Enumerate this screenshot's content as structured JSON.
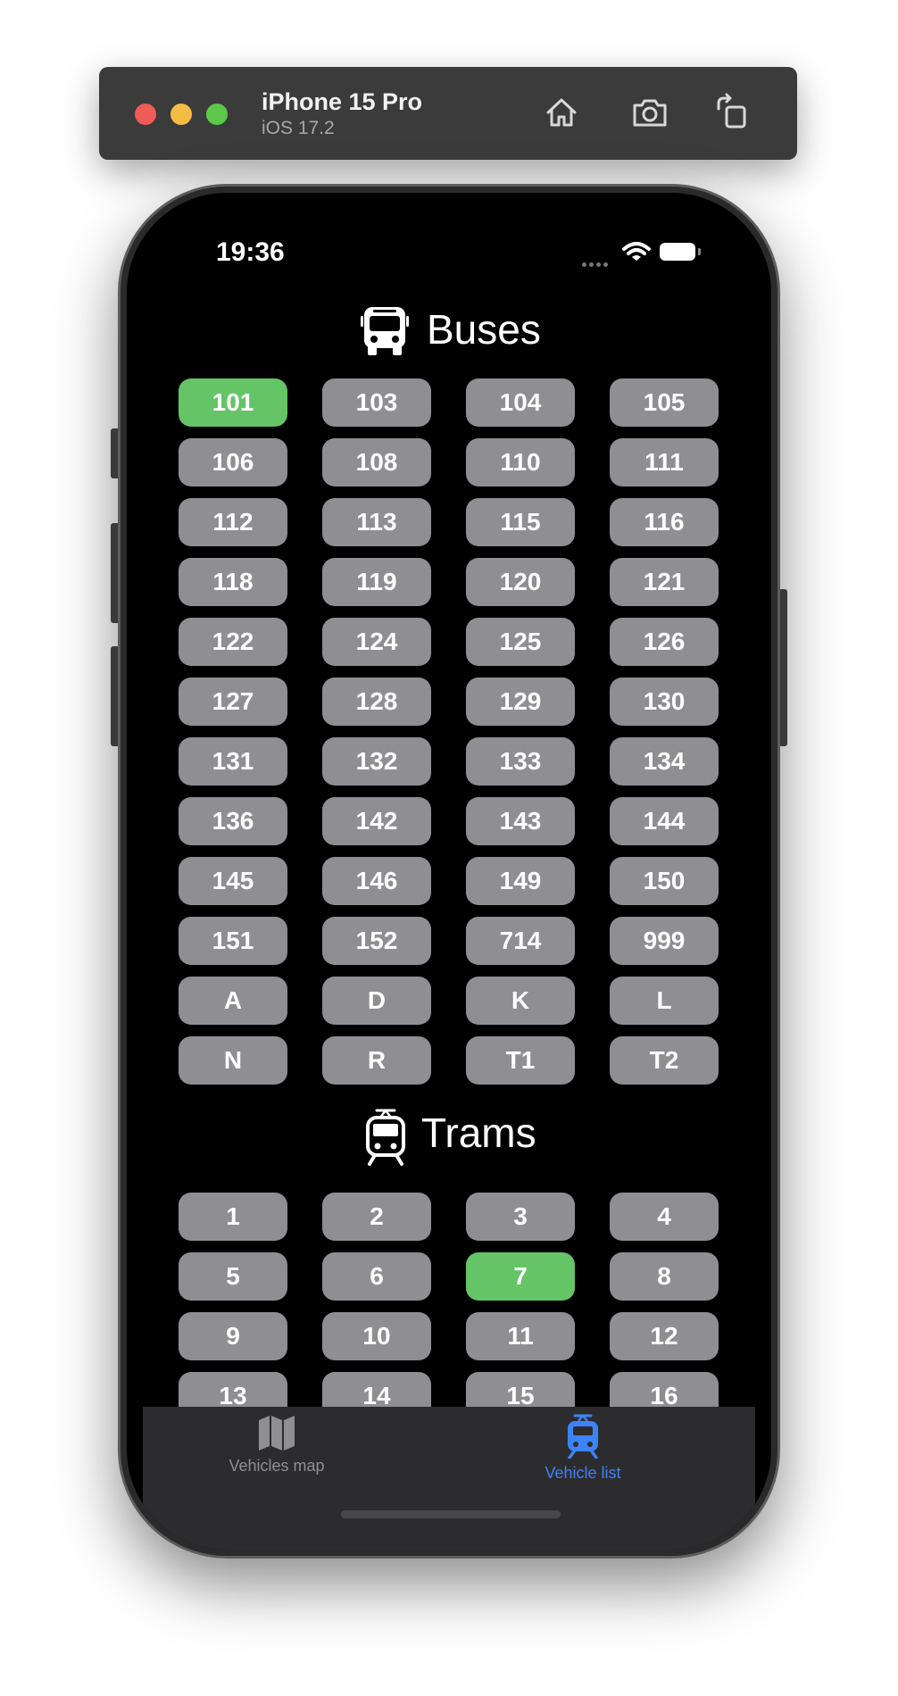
{
  "simulator": {
    "device_name": "iPhone 15 Pro",
    "os_version": "iOS 17.2",
    "buttons": [
      {
        "icon": "home-icon"
      },
      {
        "icon": "screenshot-camera-icon"
      },
      {
        "icon": "rotate-icon"
      }
    ]
  },
  "status_bar": {
    "time": "19:36"
  },
  "buses": {
    "title": "Buses",
    "icon": "bus-icon",
    "routes": [
      "101",
      "103",
      "104",
      "105",
      "106",
      "108",
      "110",
      "111",
      "112",
      "113",
      "115",
      "116",
      "118",
      "119",
      "120",
      "121",
      "122",
      "124",
      "125",
      "126",
      "127",
      "128",
      "129",
      "130",
      "131",
      "132",
      "133",
      "134",
      "136",
      "142",
      "143",
      "144",
      "145",
      "146",
      "149",
      "150",
      "151",
      "152",
      "714",
      "999",
      "A",
      "D",
      "K",
      "L",
      "N",
      "R",
      "T1",
      "T2"
    ],
    "selected": [
      "101"
    ]
  },
  "trams": {
    "title": "Trams",
    "icon": "tram-icon",
    "routes": [
      "1",
      "2",
      "3",
      "4",
      "5",
      "6",
      "7",
      "8",
      "9",
      "10",
      "11",
      "12",
      "13",
      "14",
      "15",
      "16"
    ],
    "selected": [
      "7"
    ]
  },
  "tab_bar": {
    "tabs": [
      {
        "label": "Vehicles map",
        "icon": "map-icon",
        "active": false
      },
      {
        "label": "Vehicle list",
        "icon": "tram-icon",
        "active": true
      }
    ]
  },
  "colors": {
    "selected": "#65c466",
    "unselected": "#8e8e93",
    "accent": "#3e82f7",
    "background": "#000000"
  }
}
